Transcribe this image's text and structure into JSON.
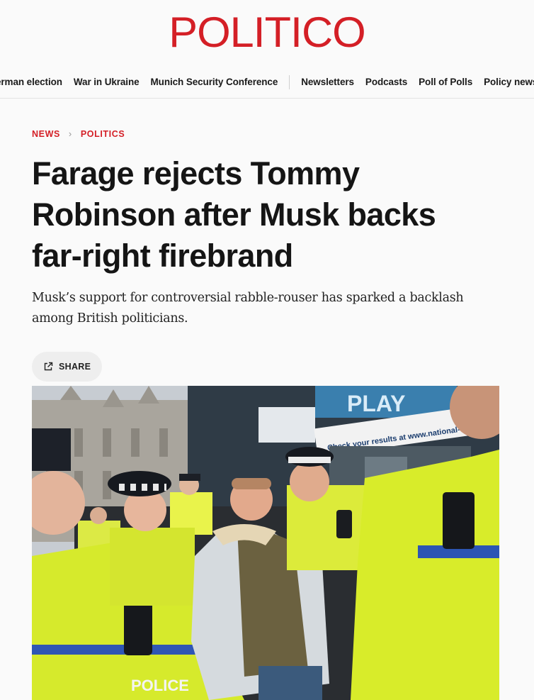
{
  "brand": {
    "logo_text": "POLITICO",
    "color": "#d41f26"
  },
  "nav": {
    "primary": [
      "erman election",
      "War in Ukraine",
      "Munich Security Conference"
    ],
    "secondary": [
      "Newsletters",
      "Podcasts",
      "Poll of Polls",
      "Policy news"
    ]
  },
  "breadcrumb": {
    "section": "NEWS",
    "subsection": "POLITICS"
  },
  "article": {
    "headline": "Farage rejects Tommy Robinson after Musk backs far-right firebrand",
    "dek": "Musk’s support for controversial rabble-rouser has sparked a backlash among British politicians.",
    "share_label": "SHARE",
    "share_icon": "share-icon"
  },
  "photo": {
    "storefront_sign": "PLAY",
    "storefront_banner": "Check your results at www.national-",
    "vest_label": "POLICE",
    "vest_label_small": "POLICE"
  }
}
